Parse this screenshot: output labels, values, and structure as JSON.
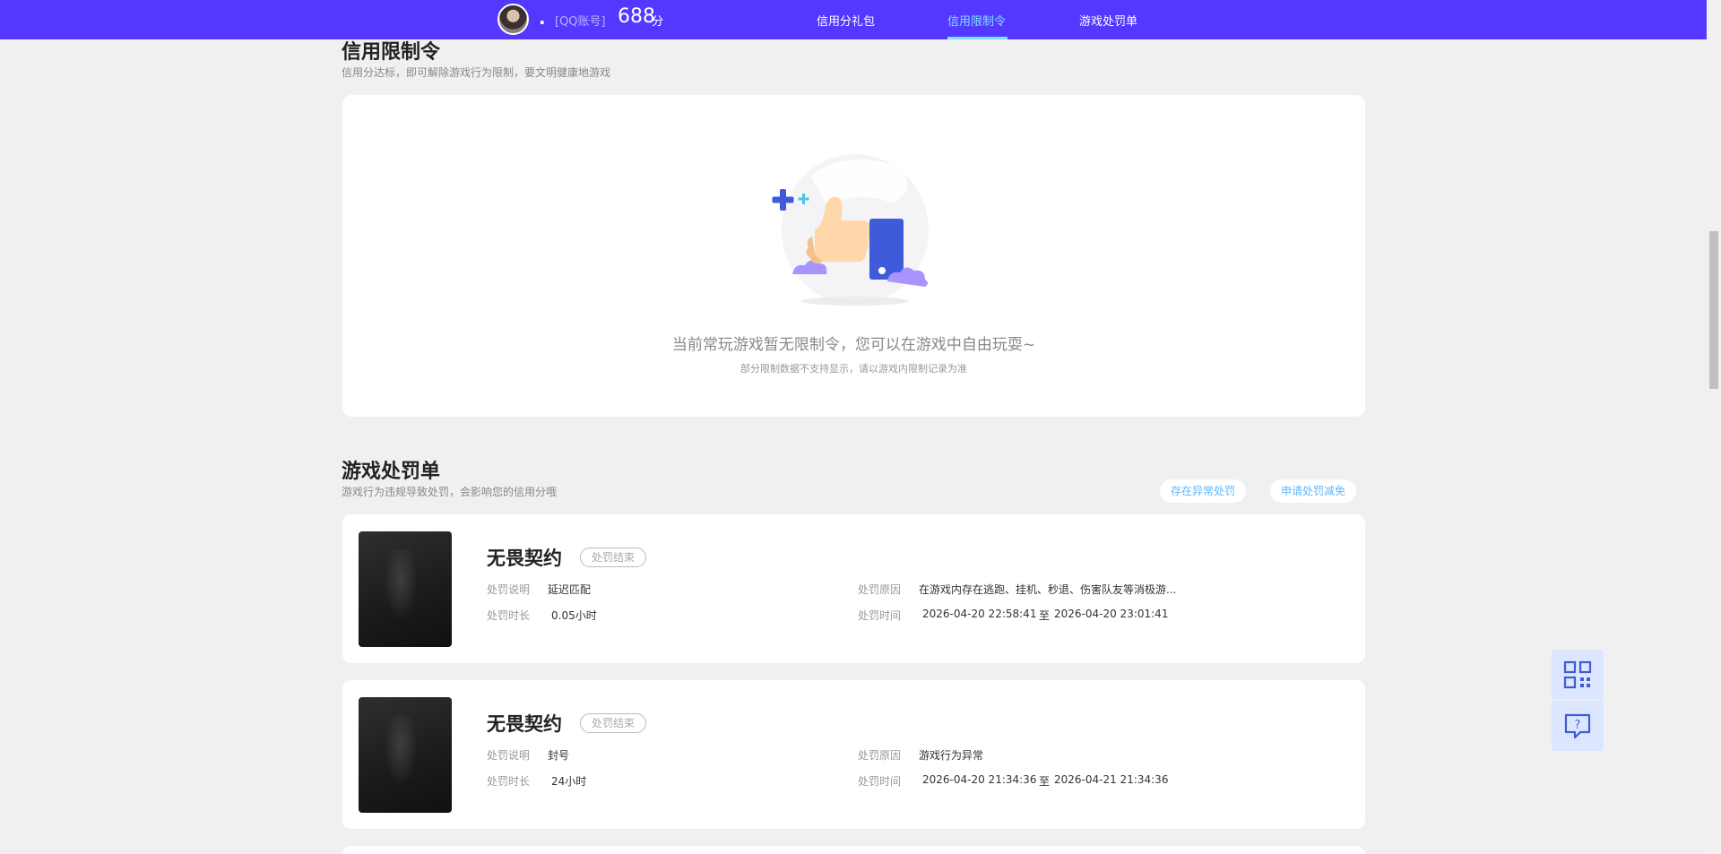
{
  "user": {
    "nickname": ".",
    "account_label": "[QQ账号]",
    "score": "688",
    "score_unit": "分"
  },
  "nav": {
    "tabs": [
      {
        "label": "信用分礼包"
      },
      {
        "label": "信用限制令"
      },
      {
        "label": "游戏处罚单"
      }
    ],
    "active_tab": "信用限制令"
  },
  "restriction": {
    "title": "信用限制令",
    "subtitle": "信用分达标，即可解除游戏行为限制，要文明健康地游戏",
    "empty_message": "当前常玩游戏暂无限制令，您可以在游戏中自由玩耍~",
    "empty_note": "部分限制数据不支持显示，请以游戏内限制记录为准"
  },
  "penalty": {
    "title": "游戏处罚单",
    "subtitle": "游戏行为违规导致处罚，会影响您的信用分哦",
    "actions": {
      "abnormal": "存在异常处罚",
      "apply": "申请处罚减免"
    },
    "field_labels": {
      "desc": "处罚说明",
      "duration": "处罚时长",
      "reason": "处罚原因",
      "time": "处罚时间"
    },
    "time_sep": "至",
    "items": [
      {
        "game": "无畏契约",
        "status": "处罚结束",
        "desc": "延迟匹配",
        "duration": "0.05小时",
        "reason": "在游戏内存在逃跑、挂机、秒退、伤害队友等消极游...",
        "start": "2026-04-20 22:58:41",
        "end": "2026-04-20 23:01:41"
      },
      {
        "game": "无畏契约",
        "status": "处罚结束",
        "desc": "封号",
        "duration": "24小时",
        "reason": "游戏行为异常",
        "start": "2026-04-20 21:34:36",
        "end": "2026-04-21 21:34:36"
      }
    ]
  },
  "float": {
    "qr_icon": "qr-code-icon",
    "help_icon": "help-chat-icon"
  },
  "colors": {
    "nav_bg": "#5438ff",
    "nav_active": "#7fe0ff",
    "pill_text": "#5cb8ff",
    "float_bg": "#dce7ff",
    "float_icon": "#3f5bd9"
  }
}
